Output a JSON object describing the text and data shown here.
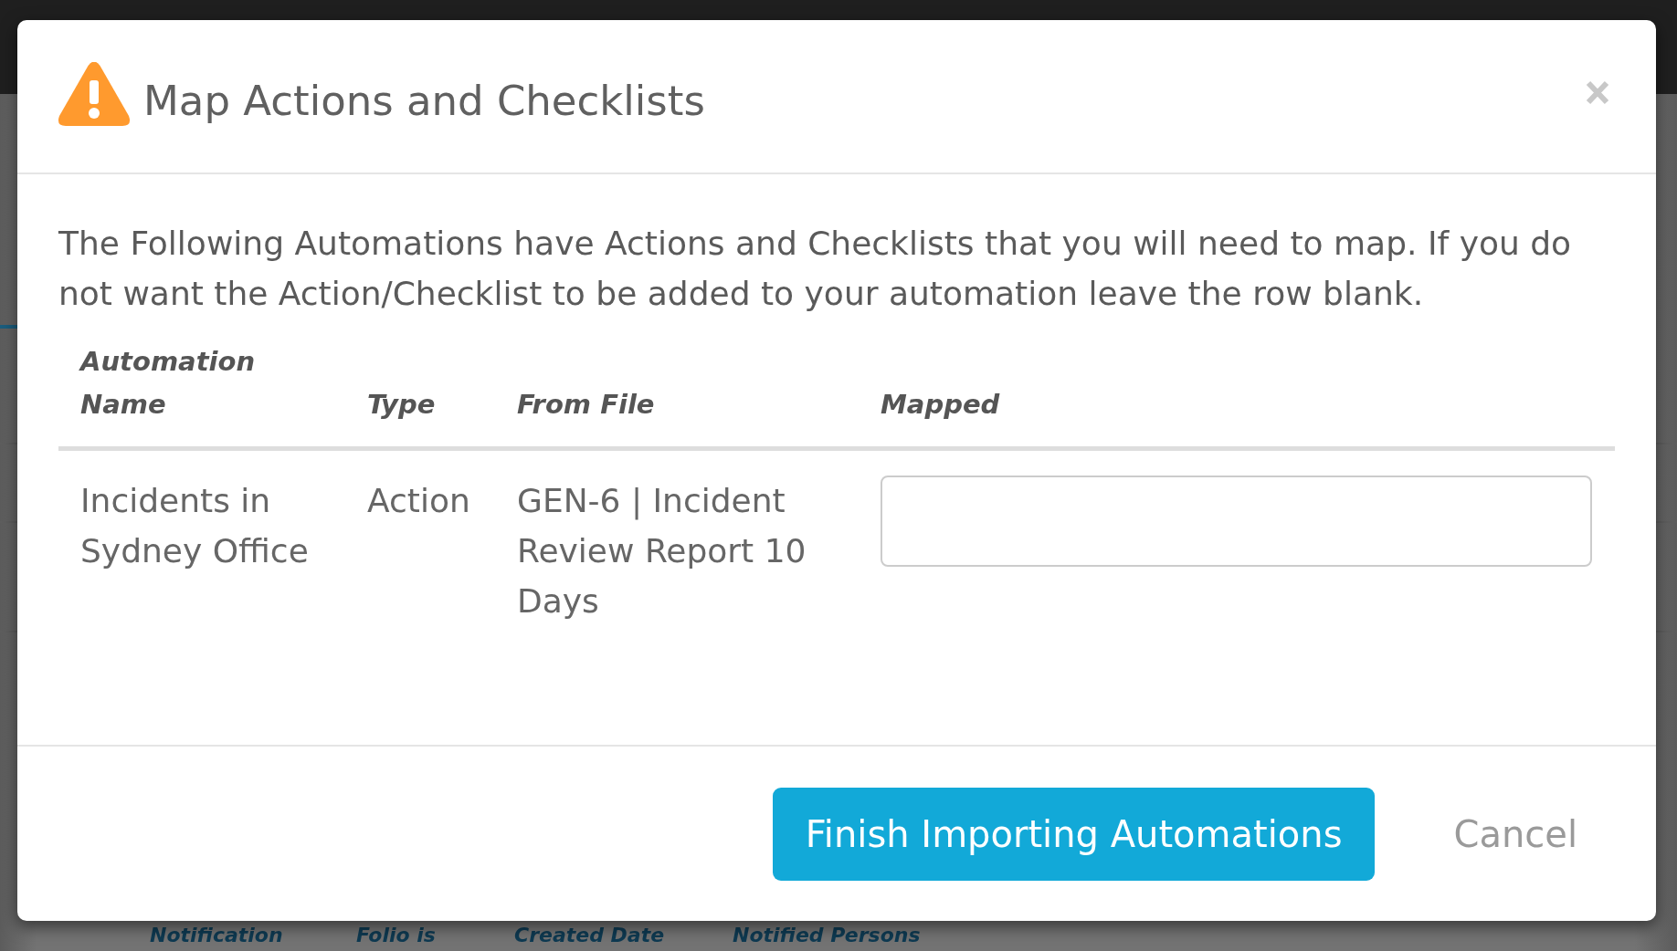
{
  "background": {
    "table_columns": [
      "Notification",
      "Folio is",
      "Created Date",
      "Notified Persons"
    ]
  },
  "dialog": {
    "title": "Map Actions and Checklists",
    "intro": "The Following Automations have Actions and Checklists that you will need to map. If you do not want the Action/Checklist to be added to your automation leave the row blank.",
    "table": {
      "columns": [
        {
          "label": "Automation Name",
          "kind": "text"
        },
        {
          "label": "Type",
          "kind": "text"
        },
        {
          "label": "From File",
          "kind": "text"
        },
        {
          "label": "Mapped",
          "kind": "input"
        }
      ],
      "rows": [
        {
          "cells": [
            "Incidents in Sydney Office",
            "Action",
            "GEN-6 | Incident Review Report 10 Days"
          ]
        }
      ]
    },
    "buttons": [
      {
        "label": "Finish Importing Automations",
        "kind": "primary"
      },
      {
        "label": "Cancel",
        "kind": "link"
      }
    ]
  }
}
